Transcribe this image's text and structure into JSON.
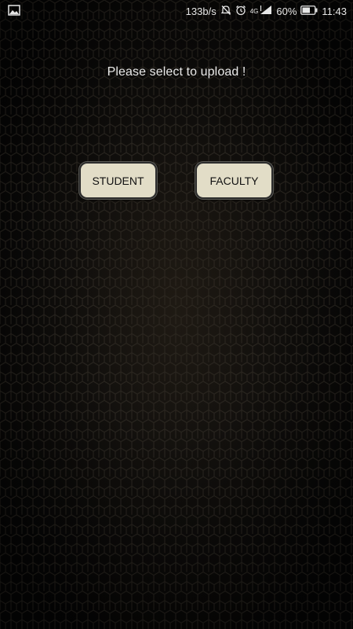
{
  "status_bar": {
    "left_icon": "image-icon",
    "network_speed": "133b/s",
    "mute_icon": "mute-icon",
    "alarm_icon": "alarm-icon",
    "network_type": "4G",
    "signal_icon": "signal-icon",
    "battery_percent": "60%",
    "battery_icon": "battery-icon",
    "time": "11:43"
  },
  "main": {
    "prompt": "Please select to upload !",
    "buttons": {
      "student_label": "STUDENT",
      "faculty_label": "FACULTY"
    }
  },
  "colors": {
    "background": "#0b0b0a",
    "button_fill": "#e2ddc7",
    "button_border": "#2c2c2c",
    "text": "#e9e9e9"
  }
}
